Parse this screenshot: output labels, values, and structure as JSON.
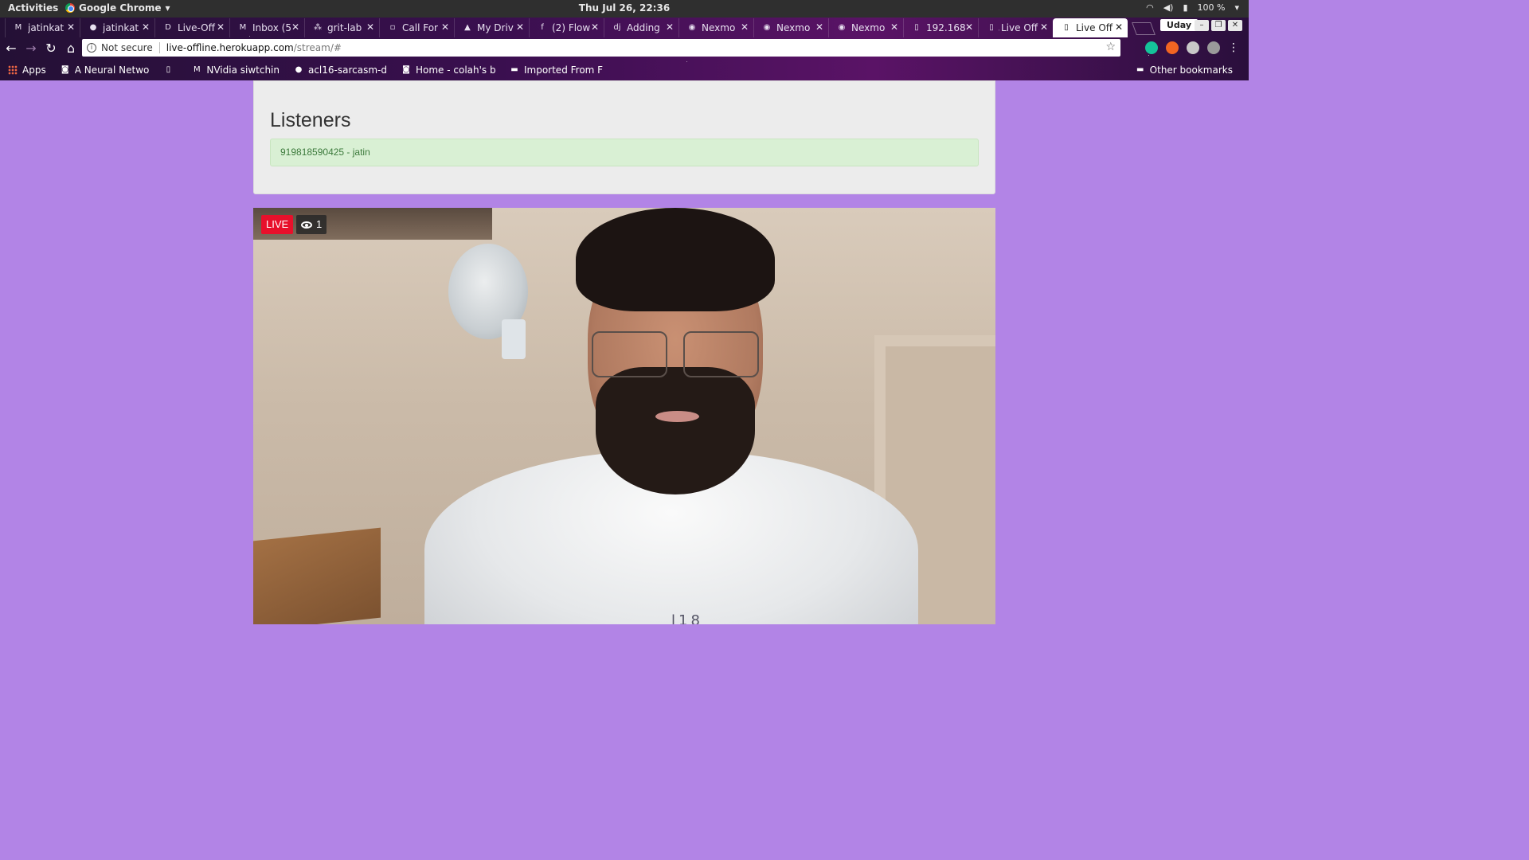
{
  "os_bar": {
    "activities": "Activities",
    "app_name": "Google Chrome",
    "clock": "Thu Jul 26, 22:36",
    "battery": "100 %"
  },
  "browser": {
    "tabs": [
      {
        "label": "jatinkat",
        "icon": "gmail-icon"
      },
      {
        "label": "jatinkat",
        "icon": "github-icon"
      },
      {
        "label": "Live-Off",
        "icon": "d-icon"
      },
      {
        "label": "Inbox (5",
        "icon": "gmail-icon"
      },
      {
        "label": "grit-lab",
        "icon": "asana-icon"
      },
      {
        "label": "Call For",
        "icon": "page-icon"
      },
      {
        "label": "My Driv",
        "icon": "drive-icon"
      },
      {
        "label": "(2) Flow",
        "icon": "facebook-icon"
      },
      {
        "label": "Adding",
        "icon": "dj-icon"
      },
      {
        "label": "Nexmo",
        "icon": "nexmo-icon"
      },
      {
        "label": "Nexmo",
        "icon": "nexmo-icon"
      },
      {
        "label": "Nexmo",
        "icon": "nexmo-icon"
      },
      {
        "label": "192.168",
        "icon": "document-icon"
      },
      {
        "label": "Live Off",
        "icon": "document-icon"
      },
      {
        "label": "Live Off",
        "icon": "document-icon",
        "active": true
      }
    ],
    "profile": "Uday",
    "security": "Not secure",
    "url_host": "live-offline.herokuapp.com",
    "url_path": "/stream/#",
    "bookmarks": [
      {
        "label": "Apps",
        "icon": "apps-grid-icon"
      },
      {
        "label": "A Neural Netwo",
        "icon": "bookmark-icon"
      },
      {
        "label": "",
        "icon": "page-icon"
      },
      {
        "label": "NVidia siwtchin",
        "icon": "medium-icon"
      },
      {
        "label": "acl16-sarcasm-d",
        "icon": "github-icon"
      },
      {
        "label": "Home - colah's b",
        "icon": "bookmark-icon"
      },
      {
        "label": "Imported From F",
        "icon": "folder-icon"
      }
    ],
    "other_bookmarks": "Other bookmarks"
  },
  "page": {
    "listeners_title": "Listeners",
    "listeners": [
      "919818590425 - jatin"
    ],
    "live_label": "LIVE",
    "viewer_count": "1",
    "shirt_text": "l18"
  },
  "colors": {
    "page_background": "#b284e6",
    "live_badge": "#e8102b",
    "listener_bg": "#d9f0d4",
    "listener_text": "#3c7a3c"
  }
}
